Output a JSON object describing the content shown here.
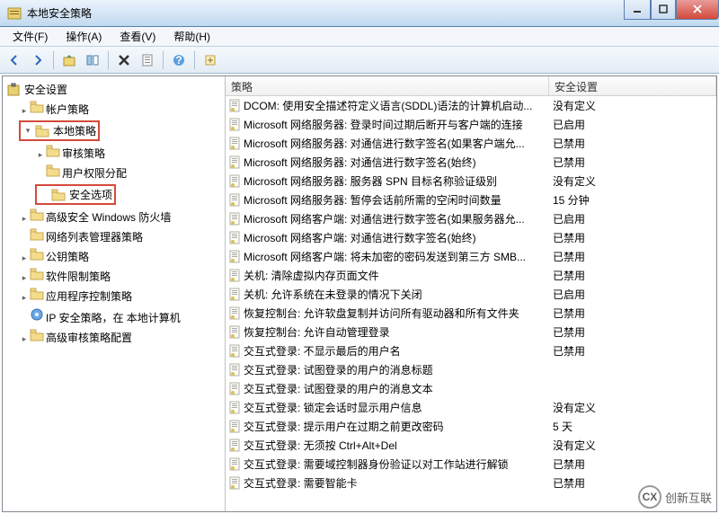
{
  "window": {
    "title": "本地安全策略"
  },
  "menu": {
    "file": "文件(F)",
    "action": "操作(A)",
    "view": "查看(V)",
    "help": "帮助(H)"
  },
  "tree": {
    "root": "安全设置",
    "items": [
      {
        "label": "帐户策略",
        "level": 1,
        "expandable": true,
        "expanded": false
      },
      {
        "label": "本地策略",
        "level": 1,
        "expandable": true,
        "expanded": true,
        "highlighted": true
      },
      {
        "label": "审核策略",
        "level": 2,
        "expandable": true,
        "expanded": false
      },
      {
        "label": "用户权限分配",
        "level": 2,
        "expandable": false,
        "expanded": false
      },
      {
        "label": "安全选项",
        "level": 2,
        "expandable": false,
        "expanded": false,
        "highlighted": true
      },
      {
        "label": "高级安全 Windows 防火墙",
        "level": 1,
        "expandable": true,
        "expanded": false
      },
      {
        "label": "网络列表管理器策略",
        "level": 1,
        "expandable": false,
        "expanded": false
      },
      {
        "label": "公钥策略",
        "level": 1,
        "expandable": true,
        "expanded": false
      },
      {
        "label": "软件限制策略",
        "level": 1,
        "expandable": true,
        "expanded": false
      },
      {
        "label": "应用程序控制策略",
        "level": 1,
        "expandable": true,
        "expanded": false
      },
      {
        "label": "IP 安全策略，在 本地计算机",
        "level": 1,
        "expandable": false,
        "expanded": false,
        "ipicon": true
      },
      {
        "label": "高级审核策略配置",
        "level": 1,
        "expandable": true,
        "expanded": false
      }
    ]
  },
  "list": {
    "headers": {
      "policy": "策略",
      "setting": "安全设置"
    },
    "rows": [
      {
        "policy": "DCOM: 使用安全描述符定义语言(SDDL)语法的计算机启动...",
        "setting": "没有定义"
      },
      {
        "policy": "Microsoft 网络服务器: 登录时间过期后断开与客户端的连接",
        "setting": "已启用"
      },
      {
        "policy": "Microsoft 网络服务器: 对通信进行数字签名(如果客户端允...",
        "setting": "已禁用"
      },
      {
        "policy": "Microsoft 网络服务器: 对通信进行数字签名(始终)",
        "setting": "已禁用"
      },
      {
        "policy": "Microsoft 网络服务器: 服务器 SPN 目标名称验证级别",
        "setting": "没有定义"
      },
      {
        "policy": "Microsoft 网络服务器: 暂停会话前所需的空闲时间数量",
        "setting": "15 分钟"
      },
      {
        "policy": "Microsoft 网络客户端: 对通信进行数字签名(如果服务器允...",
        "setting": "已启用"
      },
      {
        "policy": "Microsoft 网络客户端: 对通信进行数字签名(始终)",
        "setting": "已禁用"
      },
      {
        "policy": "Microsoft 网络客户端: 将未加密的密码发送到第三方 SMB...",
        "setting": "已禁用"
      },
      {
        "policy": "关机: 清除虚拟内存页面文件",
        "setting": "已禁用"
      },
      {
        "policy": "关机: 允许系统在未登录的情况下关闭",
        "setting": "已启用"
      },
      {
        "policy": "恢复控制台: 允许软盘复制并访问所有驱动器和所有文件夹",
        "setting": "已禁用"
      },
      {
        "policy": "恢复控制台: 允许自动管理登录",
        "setting": "已禁用"
      },
      {
        "policy": "交互式登录: 不显示最后的用户名",
        "setting": "已禁用"
      },
      {
        "policy": "交互式登录: 试图登录的用户的消息标题",
        "setting": ""
      },
      {
        "policy": "交互式登录: 试图登录的用户的消息文本",
        "setting": ""
      },
      {
        "policy": "交互式登录: 锁定会话时显示用户信息",
        "setting": "没有定义"
      },
      {
        "policy": "交互式登录: 提示用户在过期之前更改密码",
        "setting": "5 天"
      },
      {
        "policy": "交互式登录: 无须按 Ctrl+Alt+Del",
        "setting": "没有定义"
      },
      {
        "policy": "交互式登录: 需要域控制器身份验证以对工作站进行解锁",
        "setting": "已禁用"
      },
      {
        "policy": "交互式登录: 需要智能卡",
        "setting": "已禁用"
      }
    ]
  },
  "watermark": {
    "text": "创新互联"
  }
}
